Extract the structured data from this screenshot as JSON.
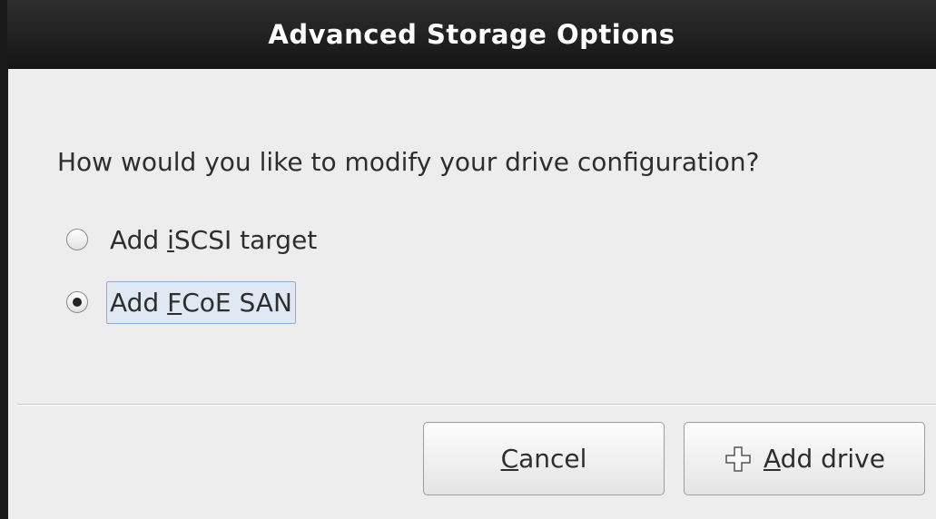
{
  "dialog": {
    "title": "Advanced Storage Options"
  },
  "content": {
    "question": "How would you like to modify your drive configuration?",
    "options": [
      {
        "prefix": "Add ",
        "mnemonic": "i",
        "suffix": "SCSI target",
        "selected": false
      },
      {
        "prefix": "Add ",
        "mnemonic": "F",
        "suffix": "CoE SAN",
        "selected": true
      }
    ]
  },
  "buttons": {
    "cancel": {
      "mnemonic": "C",
      "rest": "ancel"
    },
    "add_drive": {
      "mnemonic": "A",
      "rest": "dd drive",
      "icon": "plus-icon"
    }
  },
  "colors": {
    "titlebar": "#1e1e1e",
    "background": "#ededed",
    "focus_highlight": "#dfe8f3",
    "focus_border": "#8faed6"
  }
}
